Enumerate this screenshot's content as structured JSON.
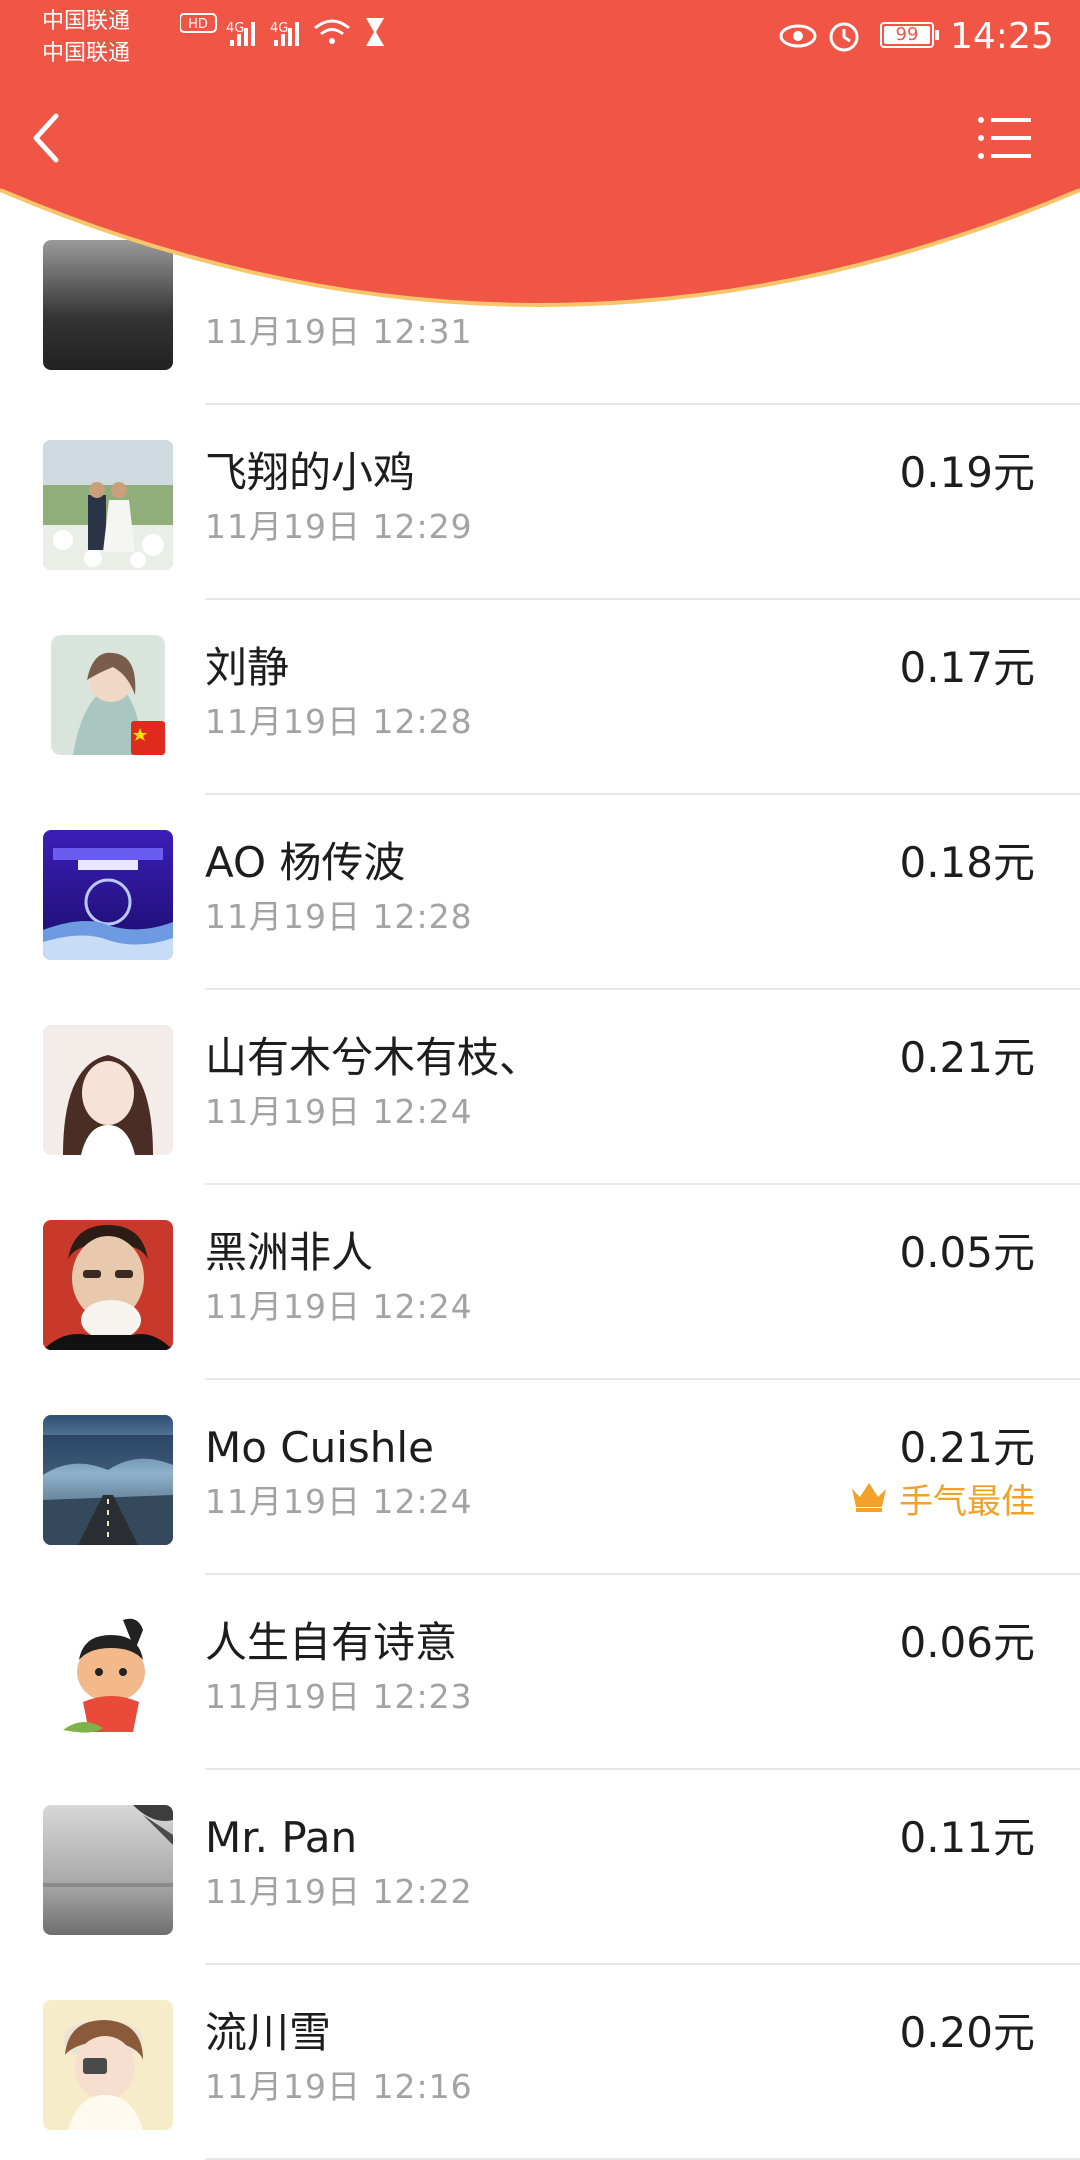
{
  "status_bar": {
    "carrier_1": "中国联通",
    "carrier_2": "中国联通",
    "hd_label": "HD",
    "network_1": "4G",
    "network_2": "4G",
    "battery": "99",
    "time": "14:25"
  },
  "header": {
    "back_icon": "chevron-left-icon",
    "menu_icon": "list-menu-icon",
    "color": "#f05545",
    "curve_border_color": "#f7c56a"
  },
  "list": {
    "partial_row": {
      "time": "11月19日  12:31"
    },
    "rows": [
      {
        "name": "飞翔的小鸡",
        "time": "11月19日  12:29",
        "amount": "0.19元"
      },
      {
        "name": "刘静",
        "time": "11月19日  12:28",
        "amount": "0.17元"
      },
      {
        "name": "AO 杨传波",
        "time": "11月19日  12:28",
        "amount": "0.18元"
      },
      {
        "name": "山有木兮木有枝、",
        "time": "11月19日  12:24",
        "amount": "0.21元"
      },
      {
        "name": "黑洲非人",
        "time": "11月19日  12:24",
        "amount": "0.05元"
      },
      {
        "name": "Mo Cuishle",
        "time": "11月19日  12:24",
        "amount": "0.21元",
        "badge": "手气最佳"
      },
      {
        "name": "人生自有诗意",
        "time": "11月19日  12:23",
        "amount": "0.06元"
      },
      {
        "name": "Mr. Pan",
        "time": "11月19日  12:22",
        "amount": "0.11元"
      },
      {
        "name": "流川雪",
        "time": "11月19日  12:16",
        "amount": "0.20元"
      }
    ]
  },
  "colors": {
    "accent": "#f05545",
    "best_luck": "#f2a129",
    "text_primary": "#1d1d1d",
    "text_secondary": "#a3a3a3"
  }
}
